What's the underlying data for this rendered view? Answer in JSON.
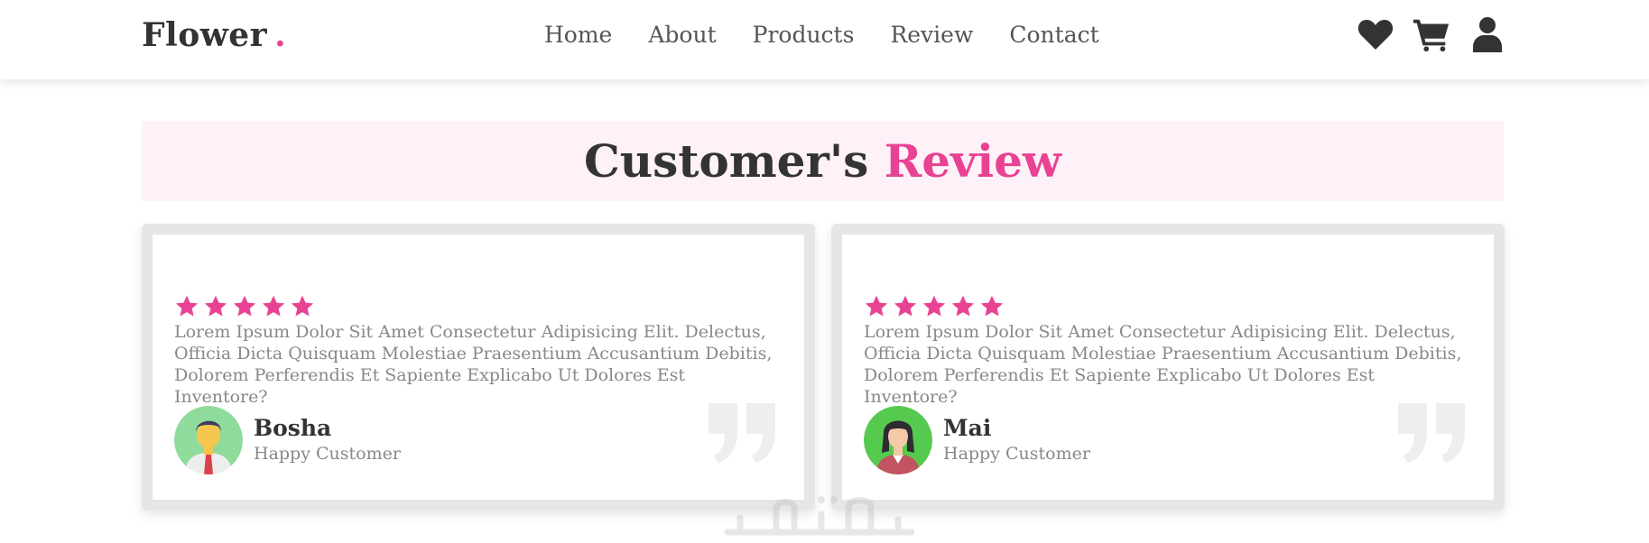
{
  "header": {
    "logo": "Flower",
    "logo_dot": ".",
    "nav": [
      "Home",
      "About",
      "Products",
      "Review",
      "Contact"
    ],
    "icons": [
      "heart-icon",
      "cart-icon",
      "user-icon"
    ]
  },
  "section": {
    "title_main": "Customer's",
    "title_accent": "Review"
  },
  "reviews": [
    {
      "rating": 5,
      "text": "Lorem Ipsum Dolor Sit Amet Consectetur Adipisicing Elit. Delectus, Officia Dicta Quisquam Molestiae Praesentium Accusantium Debitis, Dolorem Perferendis Et Sapiente Explicabo Ut Dolores Est Inventore?",
      "name": "Bosha",
      "role": "Happy Customer"
    },
    {
      "rating": 5,
      "text": "Lorem Ipsum Dolor Sit Amet Consectetur Adipisicing Elit. Delectus, Officia Dicta Quisquam Molestiae Praesentium Accusantium Debitis, Dolorem Perferendis Et Sapiente Explicabo Ut Dolores Est Inventore?",
      "name": "Mai",
      "role": "Happy Customer"
    }
  ],
  "colors": {
    "accent": "#e84393",
    "heading_bg": "#fff1f8",
    "card_border": "#e6e6e6"
  }
}
